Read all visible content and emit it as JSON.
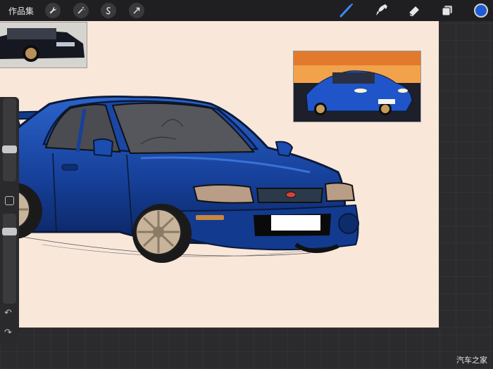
{
  "app": {
    "gallery_label": "作品集"
  },
  "toolbar": {
    "left_tools": [
      "wrench-icon",
      "magic-wand-icon",
      "selection-icon",
      "transform-icon"
    ],
    "right_tools": [
      "brush-icon",
      "smudge-icon",
      "eraser-icon",
      "layers-icon"
    ],
    "active_tool": "brush-icon",
    "current_color": "#1f5bd6",
    "accent_color": "#3a8bff"
  },
  "sidebar": {
    "brush_size_level": 0.37,
    "opacity_level": 0.83
  },
  "watermark": "汽车之家"
}
